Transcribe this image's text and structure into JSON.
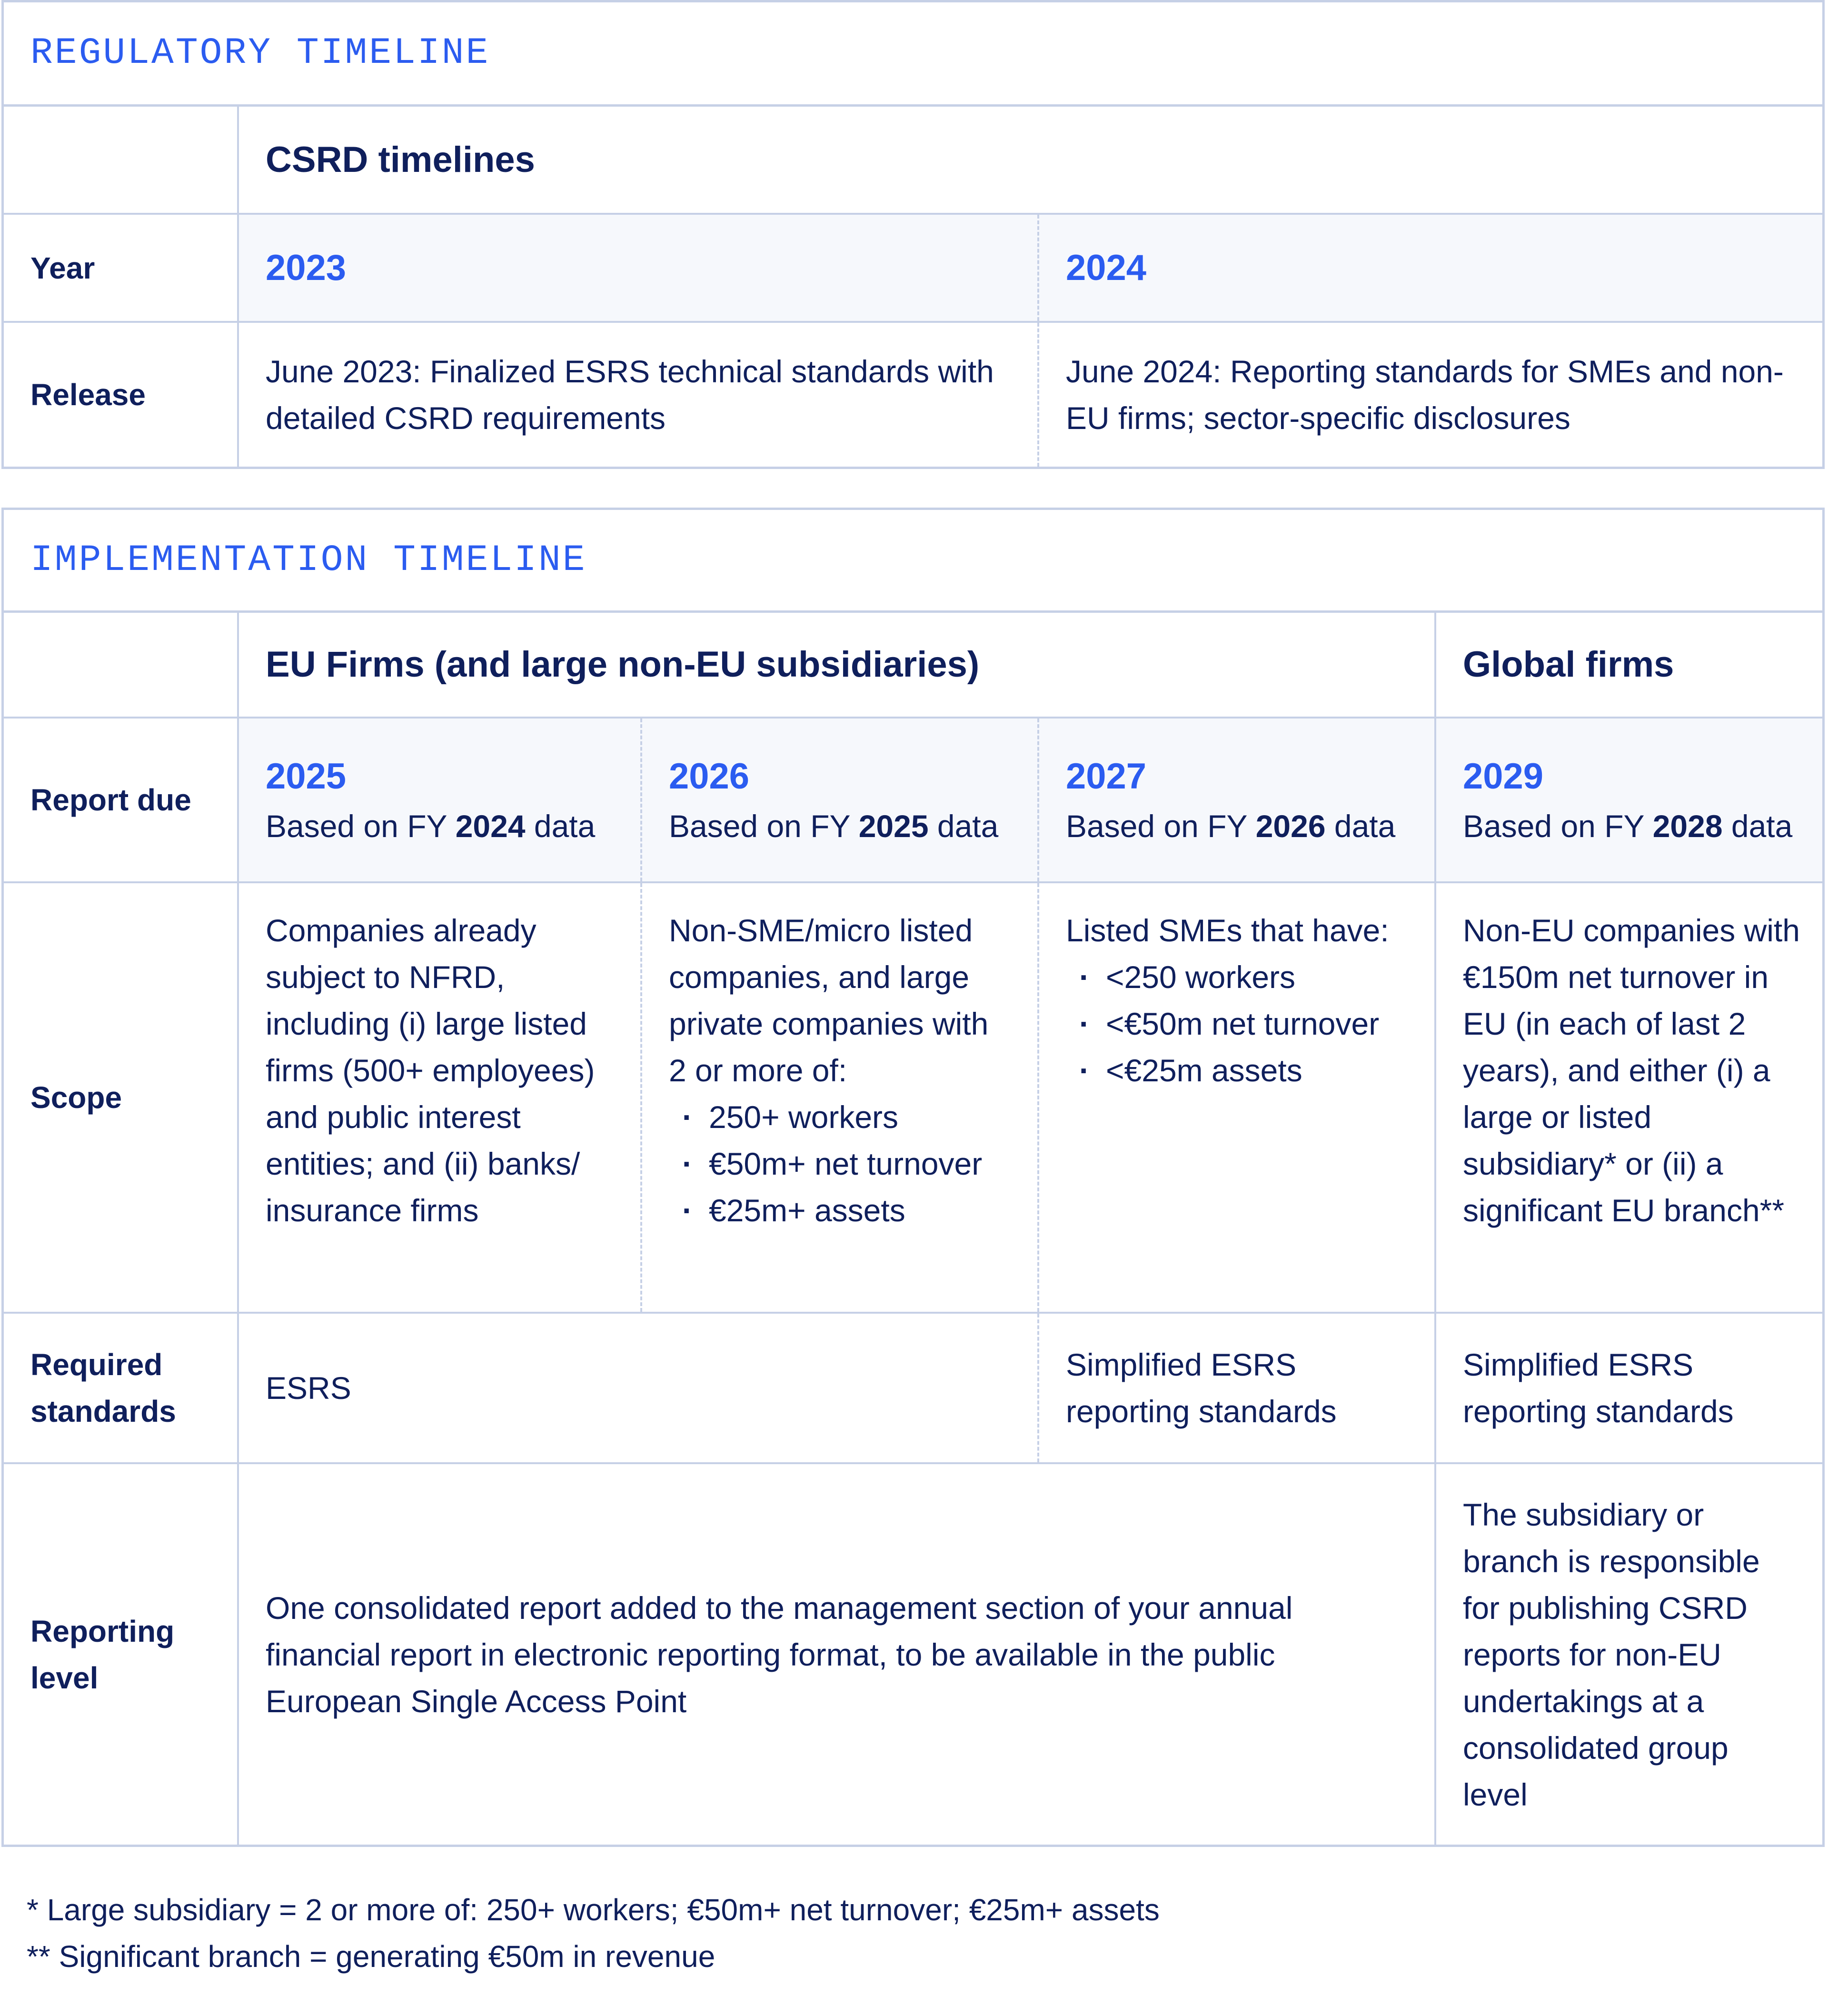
{
  "regulatory": {
    "section_title": "REGULATORY TIMELINE",
    "header": "CSRD timelines",
    "row_labels": {
      "year": "Year",
      "release": "Release"
    },
    "columns": [
      {
        "year": "2023",
        "release": "June 2023: Finalized ESRS technical standards with detailed CSRD requirements"
      },
      {
        "year": "2024",
        "release": "June 2024: Reporting standards for SMEs and non-EU firms; sector-specific disclosures"
      }
    ]
  },
  "implementation": {
    "section_title": "IMPLEMENTATION TIMELINE",
    "group_headers": {
      "eu": "EU Firms (and large non-EU subsidiaries)",
      "global": "Global firms"
    },
    "row_labels": {
      "report_due": "Report due",
      "scope": "Scope",
      "required_standards": "Required standards",
      "reporting_level": "Reporting level"
    },
    "report_due_prefix": "Based on FY ",
    "report_due_suffix": " data",
    "columns": [
      {
        "year": "2025",
        "fy": "2024",
        "scope_text": "Companies already subject to NFRD, including (i) large listed firms (500+ employees) and public interest entities; and (ii) banks/ insurance firms",
        "scope_bullets": []
      },
      {
        "year": "2026",
        "fy": "2025",
        "scope_text": "Non-SME/micro listed companies, and large private companies with 2 or more of:",
        "scope_bullets": [
          "250+ workers",
          "€50m+ net turnover",
          "€25m+ assets"
        ]
      },
      {
        "year": "2027",
        "fy": "2026",
        "scope_text": "Listed SMEs that have:",
        "scope_bullets": [
          "<250 workers",
          "<€50m net turnover",
          "<€25m assets"
        ]
      },
      {
        "year": "2029",
        "fy": "2028",
        "scope_text": "Non-EU companies with €150m net turnover in EU (in each of last 2 years), and either (i) a large or listed subsidiary* or (ii) a significant EU branch**",
        "scope_bullets": []
      }
    ],
    "required_standards": {
      "eu_2025_2026": "ESRS",
      "eu_2027": "Simplified ESRS reporting standards",
      "global": "Simplified ESRS reporting standards"
    },
    "reporting_level": {
      "eu": "One consolidated report added to the management section of your annual financial report in electronic reporting format, to be available in the public European Single Access Point",
      "global": "The subsidiary or branch is responsible for publishing CSRD reports for non-EU undertakings at a consolidated group level"
    }
  },
  "footnotes": [
    "* Large subsidiary = 2 or more of: 250+ workers; €50m+ net turnover; €25m+ assets",
    "** Significant branch = generating €50m in revenue"
  ],
  "colors": {
    "accent": "#2b5cf0",
    "text": "#0f1f5c",
    "border": "#c6d0e6",
    "shade": "#f6f8fc"
  }
}
